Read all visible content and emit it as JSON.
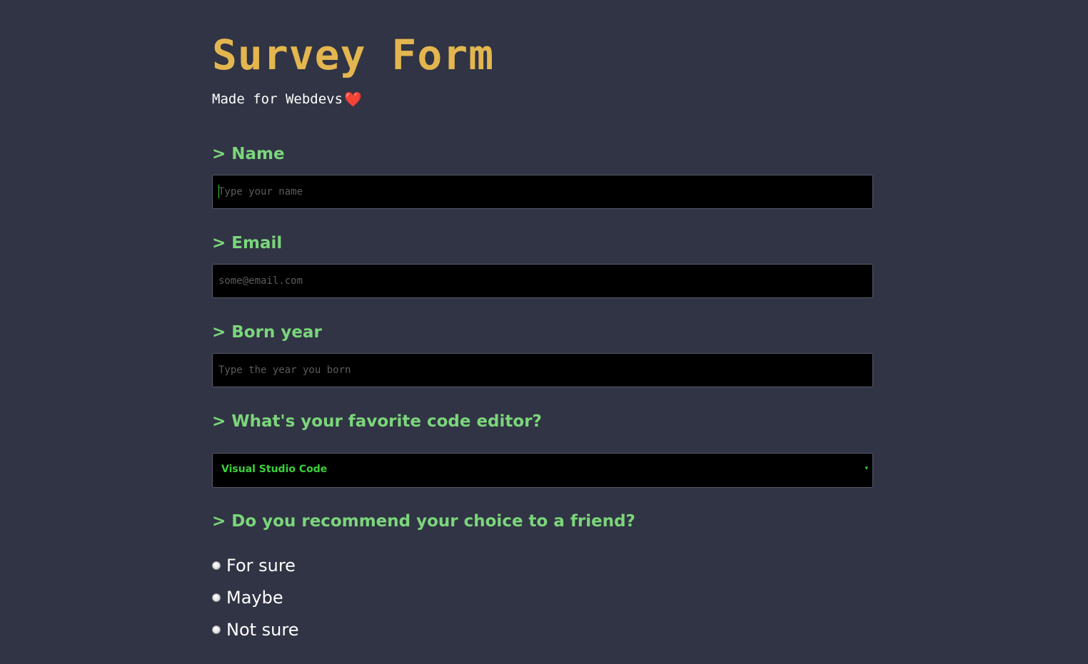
{
  "header": {
    "title": "Survey Form",
    "subtitle": "Made for Webdevs",
    "subtitle_emoji": "❤️"
  },
  "questions": {
    "chevron": ">",
    "name": {
      "label": "Name",
      "placeholder": "Type your name",
      "value": ""
    },
    "email": {
      "label": "Email",
      "placeholder": "some@email.com",
      "value": ""
    },
    "born_year": {
      "label": "Born year",
      "placeholder": "Type the year you born",
      "value": ""
    },
    "editor": {
      "label": "What's your favorite code editor?",
      "selected": "Visual Studio Code",
      "arrow": "▾"
    },
    "recommend": {
      "label": "Do you recommend your choice to a friend?",
      "options": [
        {
          "label": "For sure",
          "checked": false
        },
        {
          "label": "Maybe",
          "checked": false
        },
        {
          "label": "Not sure",
          "checked": false
        }
      ]
    }
  },
  "colors": {
    "background": "#313444",
    "title": "#e3b64f",
    "question_label": "#7bd67b",
    "select_text": "#3ad13a",
    "field_background": "#000000"
  }
}
